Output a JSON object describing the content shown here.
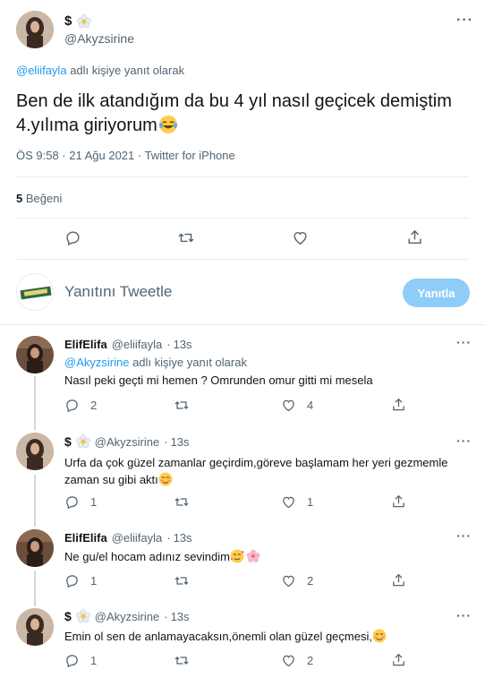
{
  "main_tweet": {
    "display_name": "$",
    "handle": "@Akyzsirine",
    "reply_to_handle": "@eliifayla",
    "reply_to_suffix": "adlı kişiye yanıt olarak",
    "text_line1": "Ben de ilk atandığım da bu 4 yıl nasıl geçicek demiştim",
    "text_line2": "4.yılıma giriyorum",
    "timestamp": "ÖS 9:58 · 21 Ağu 2021 · Twitter for iPhone",
    "likes_count": "5",
    "likes_label": "Beğeni"
  },
  "compose": {
    "placeholder": "Yanıtını Tweetle",
    "reply_button": "Yanıtla"
  },
  "replies": [
    {
      "display_name": "ElifElifa",
      "handle": "@eliifayla",
      "time": "13s",
      "reply_to_handle": "@Akyzsirine",
      "reply_to_suffix": "adlı kişiye yanıt olarak",
      "text": "Nasıl peki geçti mi hemen ? Omrunden omur gitti mi mesela",
      "replies": "2",
      "likes": "4"
    },
    {
      "display_name": "$",
      "handle": "@Akyzsirine",
      "time": "13s",
      "text_line1": "Urfa da çok güzel zamanlar geçirdim,göreve başlamam her yeri gezmemle",
      "text_line2": "zaman su gibi aktı",
      "replies": "1",
      "likes": "1"
    },
    {
      "display_name": "ElifElifa",
      "handle": "@eliifayla",
      "time": "13s",
      "text": "Ne gu/el hocam adınız sevindim",
      "replies": "1",
      "likes": "2"
    },
    {
      "display_name": "$",
      "handle": "@Akyzsirine",
      "time": "13s",
      "text": "Emin ol sen de anlamayacaksın,önemli olan güzel geçmesi,",
      "replies": "1",
      "likes": "2"
    }
  ]
}
